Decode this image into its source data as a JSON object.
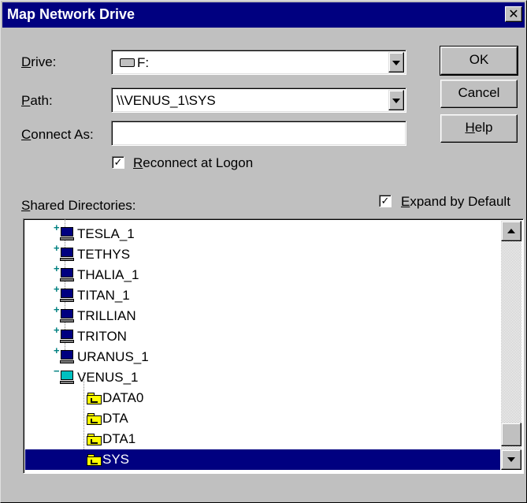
{
  "window": {
    "title": "Map Network Drive",
    "close_label": "✕"
  },
  "form": {
    "drive_label": "Drive:",
    "drive_value": "F:",
    "path_label": "Path:",
    "path_value": "\\\\VENUS_1\\SYS",
    "connect_as_label": "Connect As:",
    "connect_as_value": "",
    "reconnect_label": "Reconnect at Logon",
    "reconnect_checked": true
  },
  "buttons": {
    "ok": "OK",
    "cancel": "Cancel",
    "help": "Help"
  },
  "shared": {
    "label": "Shared Directories:",
    "expand_label": "Expand by Default",
    "expand_checked": true
  },
  "tree": {
    "items": [
      {
        "label": "TESLA_1",
        "type": "server",
        "expander": "+"
      },
      {
        "label": "TETHYS",
        "type": "server",
        "expander": "+"
      },
      {
        "label": "THALIA_1",
        "type": "server",
        "expander": "+"
      },
      {
        "label": "TITAN_1",
        "type": "server",
        "expander": "+"
      },
      {
        "label": "TRILLIAN",
        "type": "server",
        "expander": "+"
      },
      {
        "label": "TRITON",
        "type": "server",
        "expander": "+"
      },
      {
        "label": "URANUS_1",
        "type": "server",
        "expander": "+"
      },
      {
        "label": "VENUS_1",
        "type": "server",
        "expander": "−"
      },
      {
        "label": "DATA0",
        "type": "folder"
      },
      {
        "label": "DTA",
        "type": "folder"
      },
      {
        "label": "DTA1",
        "type": "folder"
      },
      {
        "label": "SYS",
        "type": "folder",
        "selected": true
      }
    ]
  },
  "icons": {
    "drive": "network-drive-icon",
    "server": "computer-icon",
    "folder": "shared-folder-icon"
  },
  "colors": {
    "title_bar": "#000080",
    "selection": "#000080",
    "face": "#c0c0c0"
  }
}
